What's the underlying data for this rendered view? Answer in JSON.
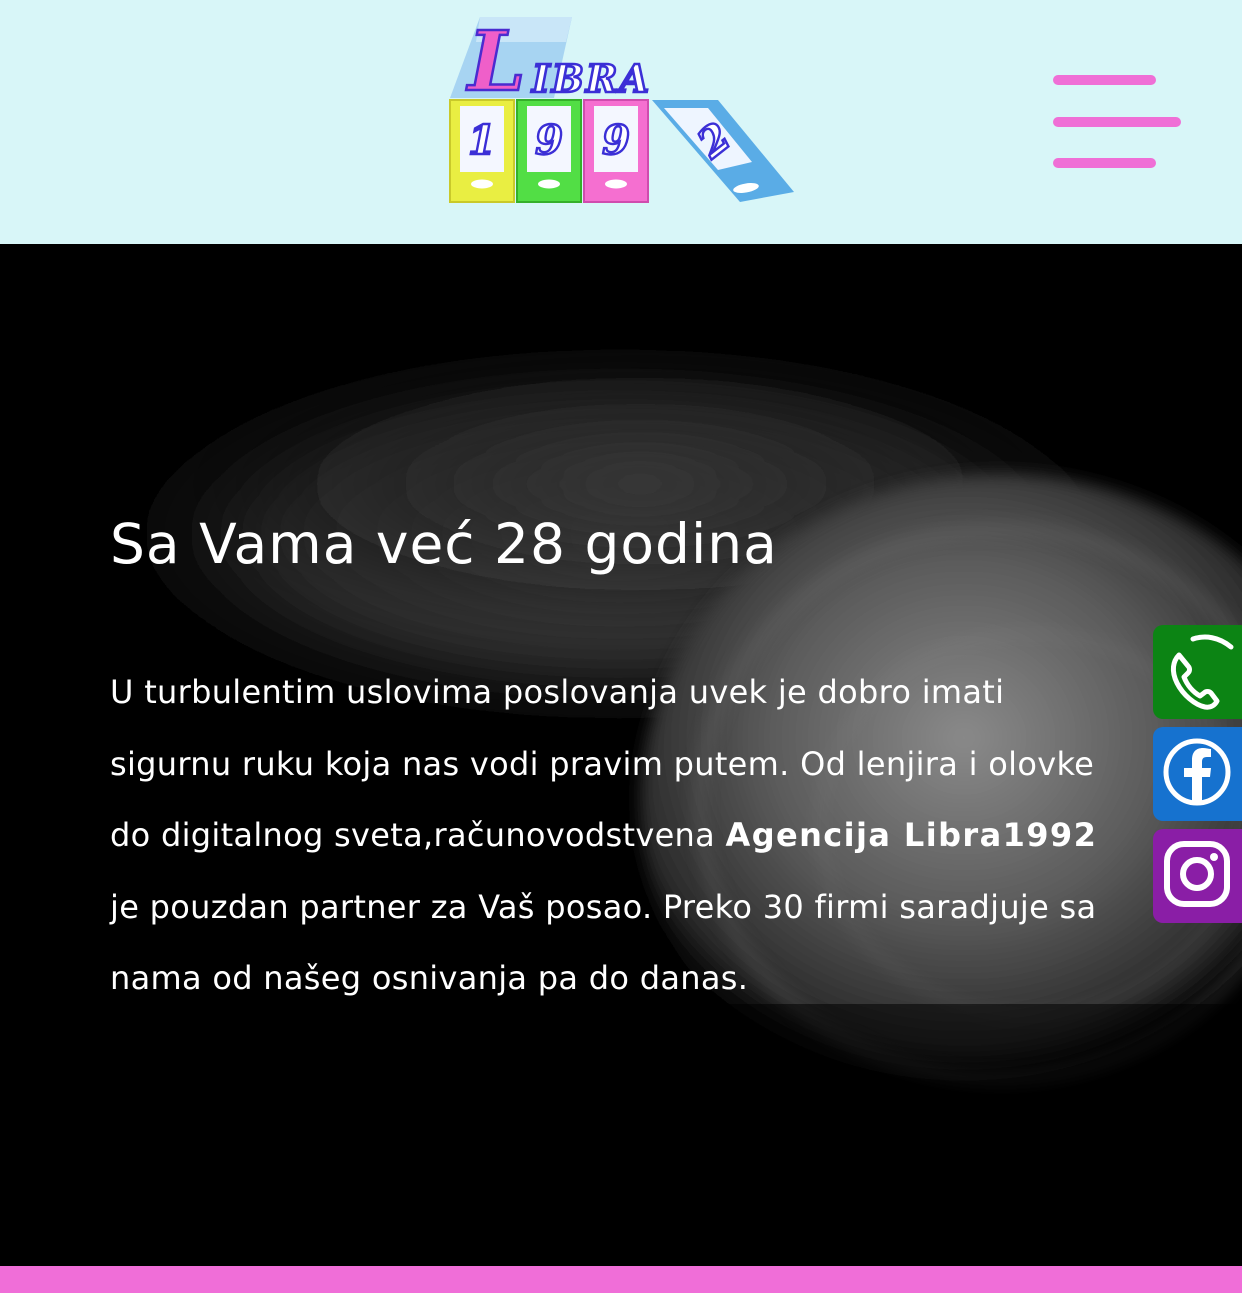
{
  "header": {
    "logo": {
      "word": "LIBRA",
      "digits": [
        "1",
        "9",
        "9",
        "2"
      ],
      "binder_colors": [
        "#e9ee42",
        "#52de45",
        "#f56fd0",
        "#5aace6"
      ]
    },
    "menu_icon": "hamburger-menu-icon",
    "menu_color": "#ef6fd6"
  },
  "hero": {
    "title": "Sa Vama već 28 godina",
    "paragraph": {
      "part1": "U turbulentim uslovima poslovanja uvek je dobro imati sigurnu ruku koja nas vodi pravim putem. Od lenjira i olovke do digitalnog sveta,računovodstvena ",
      "bold": "Agencija Libra1992",
      "part2": " je pouzdan partner za Vaš posao. Preko 30 firmi saradjuje sa nama od našeg osnivanja pa do danas."
    }
  },
  "social": {
    "phone": {
      "icon": "phone-icon",
      "color": "#0c8414"
    },
    "facebook": {
      "icon": "facebook-icon",
      "color": "#1672cf"
    },
    "instagram": {
      "icon": "instagram-icon",
      "color": "#8a1ea6"
    }
  },
  "footer": {
    "strip_color": "#f06ed8"
  }
}
